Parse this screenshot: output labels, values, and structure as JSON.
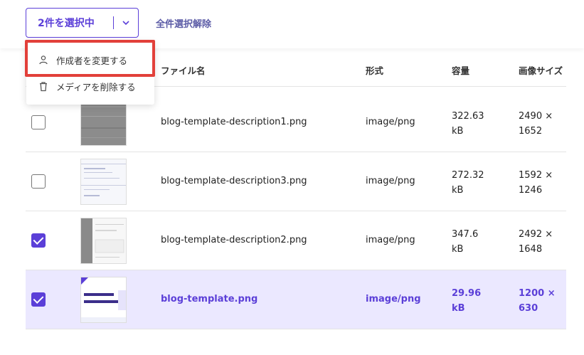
{
  "toolbar": {
    "selection_label": "2件を選択中",
    "deselect_all": "全件選択解除"
  },
  "menu": {
    "items": [
      {
        "label": "作成者を変更する",
        "icon": "user-icon"
      },
      {
        "label": "メディアを削除する",
        "icon": "trash-icon"
      }
    ]
  },
  "table": {
    "columns": [
      "ファイル名",
      "形式",
      "容量",
      "画像サイズ"
    ],
    "rows": [
      {
        "checked": false,
        "name": "blog-template-description1.png",
        "type": "image/png",
        "size_num": "322.63",
        "size_unit": "kB",
        "dim_w": "2490 ×",
        "dim_h": "1652"
      },
      {
        "checked": false,
        "name": "blog-template-description3.png",
        "type": "image/png",
        "size_num": "272.32",
        "size_unit": "kB",
        "dim_w": "1592 ×",
        "dim_h": "1246"
      },
      {
        "checked": true,
        "name": "blog-template-description2.png",
        "type": "image/png",
        "size_num": "347.6",
        "size_unit": "kB",
        "dim_w": "2492 ×",
        "dim_h": "1648"
      },
      {
        "checked": true,
        "name": "blog-template.png",
        "type": "image/png",
        "size_num": "29.96",
        "size_unit": "kB",
        "dim_w": "1200 ×",
        "dim_h": "630"
      }
    ]
  },
  "colors": {
    "accent": "#5b3fd8",
    "highlight_border": "#e2403a",
    "selected_row": "#ebe8ff"
  }
}
